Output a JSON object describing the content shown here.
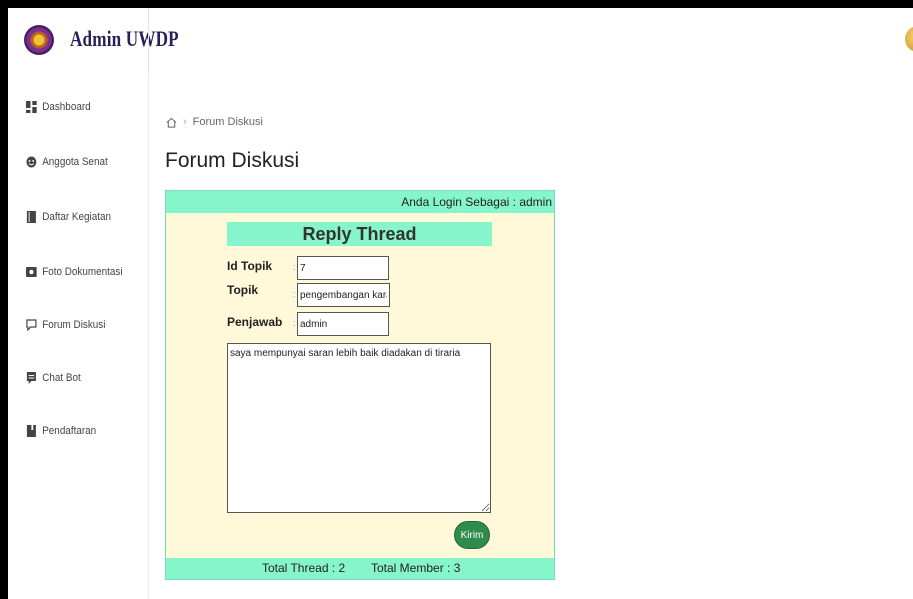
{
  "header": {
    "brand": "Admin UWDP"
  },
  "sidebar": {
    "items": [
      {
        "label": "Dashboard",
        "icon": "dashboard-icon"
      },
      {
        "label": "Anggota Senat",
        "icon": "user-circle-icon"
      },
      {
        "label": "Daftar Kegiatan",
        "icon": "book-icon"
      },
      {
        "label": "Foto Dokumentasi",
        "icon": "photo-icon"
      },
      {
        "label": "Forum Diskusi",
        "icon": "chat-icon"
      },
      {
        "label": "Chat Bot",
        "icon": "bot-icon"
      },
      {
        "label": "Pendaftaran",
        "icon": "register-icon"
      }
    ]
  },
  "breadcrumb": {
    "icon": "home-icon",
    "separator": "›",
    "current": "Forum Diskusi"
  },
  "page": {
    "title": "Forum Diskusi"
  },
  "form": {
    "login_status": "Anda Login Sebagai : admin",
    "heading": "Reply Thread",
    "colon": ":",
    "fields": {
      "id_topik": {
        "label": "Id Topik",
        "value": "7"
      },
      "topik": {
        "label": "Topik",
        "value": "pengembangan karakte"
      },
      "penjawab": {
        "label": "Penjawab",
        "value": "admin"
      }
    },
    "message": "saya mempunyai saran lebih baik diadakan di tiraria",
    "submit_label": "Kirim"
  },
  "stats": {
    "total_thread": "Total Thread : 2",
    "total_member": "Total Member : 3"
  },
  "colors": {
    "accent_bar": "#86f5cc",
    "card_bg": "#fff8d9",
    "submit_button": "#2e8b4c",
    "brand_text": "#2a1f5a"
  }
}
